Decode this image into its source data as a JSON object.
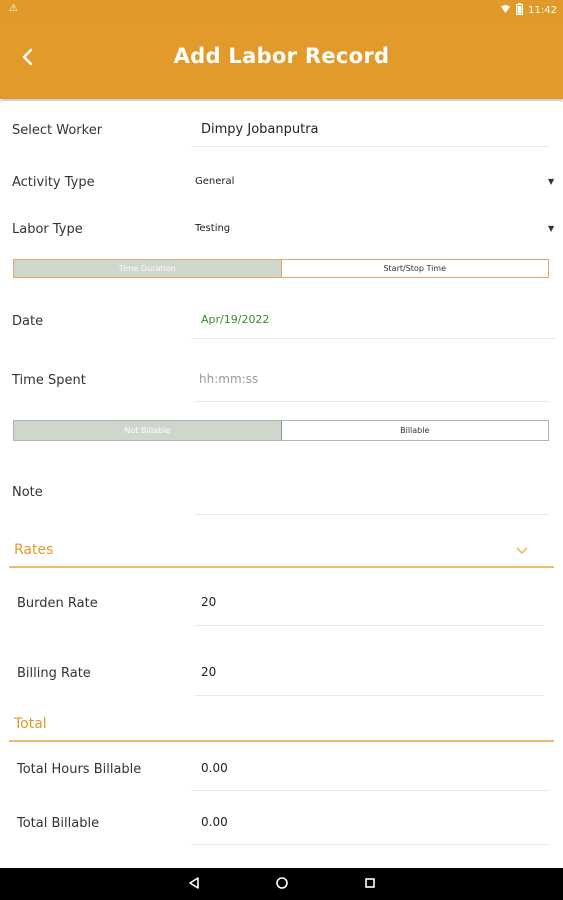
{
  "status_bar": {
    "time": "11:42"
  },
  "app_bar": {
    "title": "Add Labor Record"
  },
  "form": {
    "worker": {
      "label": "Select Worker",
      "value": "Dimpy Jobanputra"
    },
    "activity_type": {
      "label": "Activity Type",
      "value": "General"
    },
    "labor_type": {
      "label": "Labor Type",
      "value": "Testing"
    },
    "time_mode": {
      "options": [
        "Time Duration",
        "Start/Stop Time"
      ],
      "selected": "Time Duration"
    },
    "date": {
      "label": "Date",
      "value": "Apr/19/2022",
      "value_color": "#3a8a2e"
    },
    "time_spent": {
      "label": "Time Spent",
      "placeholder": "hh:mm:ss"
    },
    "billable_mode": {
      "options": [
        "Not Billable",
        "Billable"
      ],
      "selected": "Not Billable"
    },
    "note": {
      "label": "Note",
      "value": ""
    }
  },
  "rates": {
    "title": "Rates",
    "burden_rate": {
      "label": "Burden Rate",
      "value": "20"
    },
    "billing_rate": {
      "label": "Billing Rate",
      "value": "20"
    }
  },
  "total": {
    "title": "Total",
    "total_hours_billable": {
      "label": "Total Hours Billable",
      "value": "0.00"
    },
    "total_billable": {
      "label": "Total Billable",
      "value": "0.00"
    }
  },
  "colors": {
    "accent": "#e29a2a",
    "segment_active": "#cfd6cb"
  },
  "icons": [
    "warning-icon",
    "wifi-icon",
    "battery-icon",
    "back-arrow-icon",
    "chevron-down-icon",
    "nav-back-icon",
    "nav-home-icon",
    "nav-recents-icon"
  ]
}
